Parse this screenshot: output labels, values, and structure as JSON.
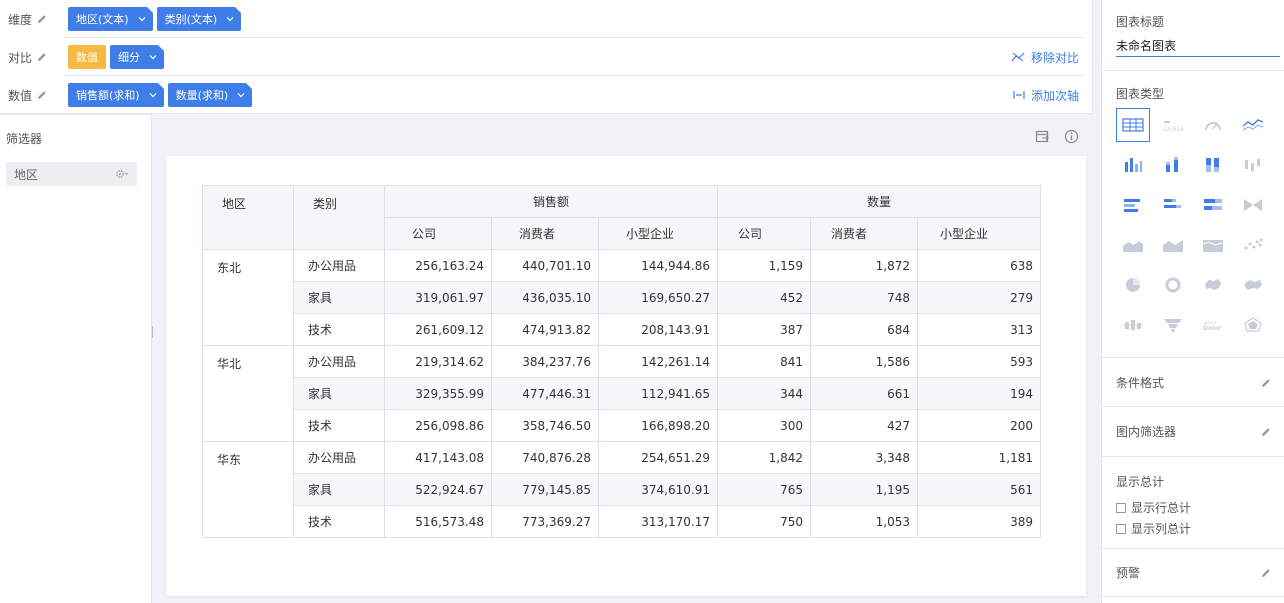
{
  "rows": {
    "dimension": {
      "label": "维度",
      "chips": [
        "地区(文本)",
        "类别(文本)"
      ]
    },
    "compare": {
      "label": "对比",
      "chips": [
        "数值",
        "细分"
      ],
      "action": "移除对比"
    },
    "measure": {
      "label": "数值",
      "chips": [
        "销售额(求和)",
        "数量(求和)"
      ],
      "action": "添加次轴"
    }
  },
  "filter": {
    "title": "筛选器",
    "items": [
      "地区"
    ]
  },
  "table": {
    "header": {
      "region": "地区",
      "category": "类别",
      "groups": [
        "销售额",
        "数量"
      ],
      "subs": [
        "公司",
        "消费者",
        "小型企业",
        "公司",
        "消费者",
        "小型企业"
      ]
    },
    "regions": [
      {
        "name": "东北",
        "rows": [
          {
            "category": "办公用品",
            "values": [
              "256,163.24",
              "440,701.10",
              "144,944.86",
              "1,159",
              "1,872",
              "638"
            ]
          },
          {
            "category": "家具",
            "values": [
              "319,061.97",
              "436,035.10",
              "169,650.27",
              "452",
              "748",
              "279"
            ]
          },
          {
            "category": "技术",
            "values": [
              "261,609.12",
              "474,913.82",
              "208,143.91",
              "387",
              "684",
              "313"
            ]
          }
        ]
      },
      {
        "name": "华北",
        "rows": [
          {
            "category": "办公用品",
            "values": [
              "219,314.62",
              "384,237.76",
              "142,261.14",
              "841",
              "1,586",
              "593"
            ]
          },
          {
            "category": "家具",
            "values": [
              "329,355.99",
              "477,446.31",
              "112,941.65",
              "344",
              "661",
              "194"
            ]
          },
          {
            "category": "技术",
            "values": [
              "256,098.86",
              "358,746.50",
              "166,898.20",
              "300",
              "427",
              "200"
            ]
          }
        ]
      },
      {
        "name": "华东",
        "rows": [
          {
            "category": "办公用品",
            "values": [
              "417,143.08",
              "740,876.28",
              "254,651.29",
              "1,842",
              "3,348",
              "1,181"
            ]
          },
          {
            "category": "家具",
            "values": [
              "522,924.67",
              "779,145.85",
              "374,610.91",
              "765",
              "1,195",
              "561"
            ]
          },
          {
            "category": "技术",
            "values": [
              "516,573.48",
              "773,369.27",
              "313,170.17",
              "750",
              "1,053",
              "389"
            ]
          }
        ]
      }
    ]
  },
  "right_panel": {
    "chart_title_label": "图表标题",
    "chart_title_value": "未命名图表",
    "chart_type_label": "图表类型",
    "conditional_format": "条件格式",
    "inner_filter": "图内筛选器",
    "show_total": "显示总计",
    "show_row_total": "显示行总计",
    "show_col_total": "显示列总计",
    "alert": "预警"
  },
  "colors": {
    "accent": "#3f7ee8",
    "yellow_chip": "#f5b944"
  },
  "icons": {
    "chart_types": [
      "table-icon",
      "kpi-number-icon",
      "gauge-icon",
      "line-icon",
      "column-icon",
      "stacked-column-icon",
      "percent-column-icon",
      "range-column-icon",
      "bar-icon",
      "stacked-bar-icon",
      "percent-bar-icon",
      "bowtie-icon",
      "area-icon",
      "stacked-area-icon",
      "heatmap-area-icon",
      "scatter-icon",
      "pie-icon",
      "donut-icon",
      "map-icon",
      "region-map-icon",
      "boxplot-icon",
      "funnel-icon",
      "word-cloud-icon",
      "radar-icon"
    ]
  }
}
